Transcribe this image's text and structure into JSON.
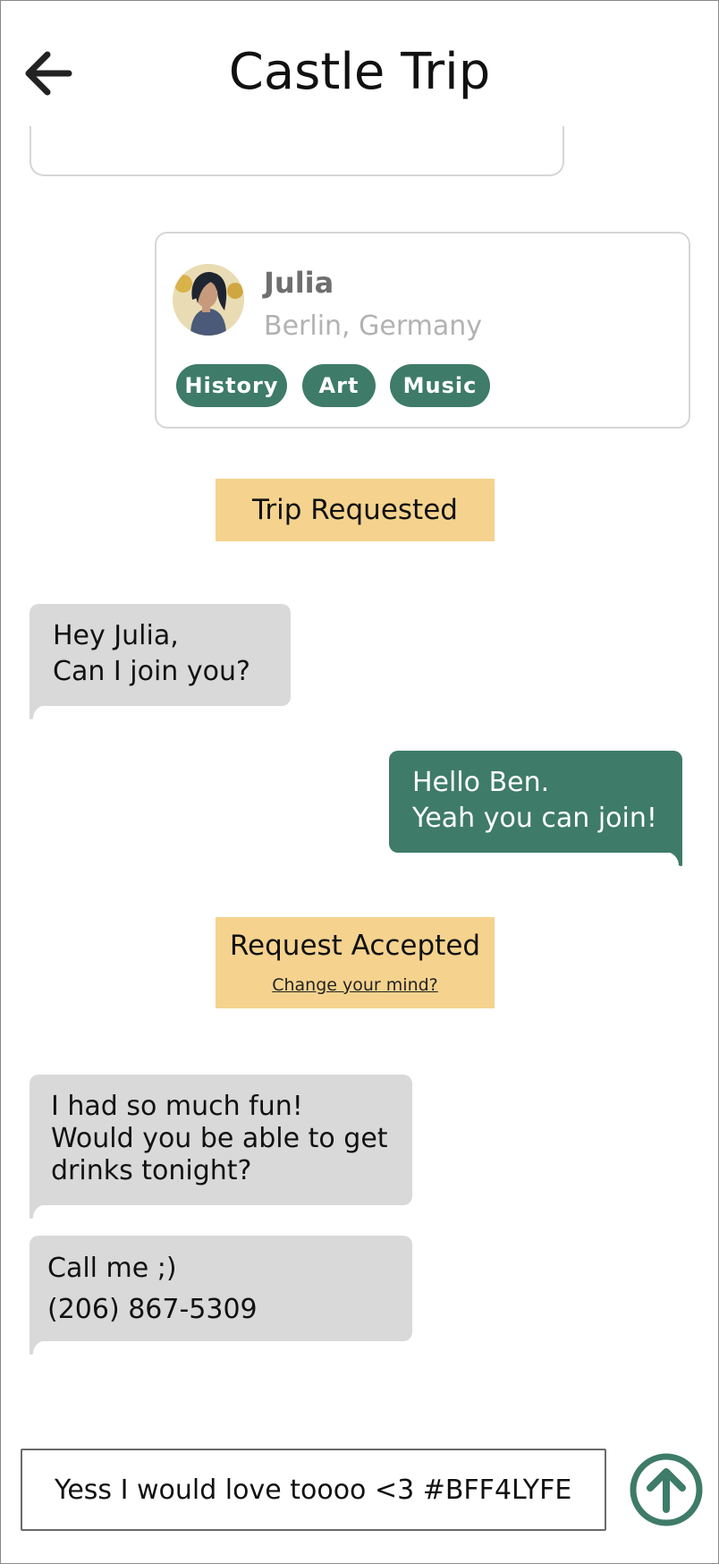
{
  "header": {
    "title": "Castle Trip",
    "back_icon": "arrow-left-icon"
  },
  "profile_card": {
    "name": "Julia",
    "location": "Berlin, Germany",
    "tags": [
      "History",
      "Art",
      "Music"
    ]
  },
  "status": {
    "trip_requested": "Trip Requested",
    "request_accepted": "Request Accepted",
    "change_mind_link": "Change your mind?"
  },
  "messages": [
    {
      "from": "other",
      "lines": [
        "Hey Julia,",
        "Can I join you?"
      ]
    },
    {
      "from": "me",
      "lines": [
        "Hello Ben.",
        "Yeah you can join!"
      ]
    },
    {
      "from": "other",
      "lines": [
        "I had so much fun!",
        "Would you be able to get",
        "drinks tonight?"
      ]
    },
    {
      "from": "other",
      "lines": [
        "Call me ;)",
        "(206) 867-5309"
      ]
    }
  ],
  "composer": {
    "value": "Yess I would love toooo <3 #BFF4LYFE",
    "send_icon": "arrow-up-circle-icon"
  },
  "colors": {
    "accent_green": "#3e7b68",
    "banner_yellow": "#f5d38e",
    "incoming_bubble": "#d9d9d9"
  }
}
